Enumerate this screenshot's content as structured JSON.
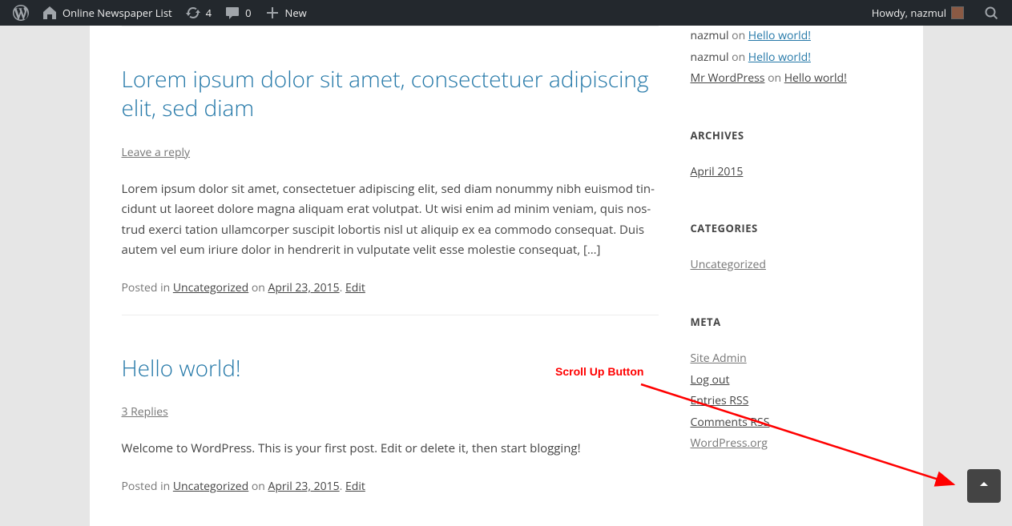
{
  "adminbar": {
    "site_title": "Online Newspaper List",
    "updates_count": "4",
    "comments_count": "0",
    "new_label": "New",
    "howdy": "Howdy, nazmul"
  },
  "posts": [
    {
      "title": "Lorem ipsum dolor sit amet, consectetuer adipiscing elit, sed diam",
      "reply": "Leave a reply",
      "body": "Lorem ipsum dolor sit amet, consectetuer adipiscing elit, sed diam nonummy nibh euismod tin-cidunt ut laoreet dolore magna aliquam erat volutpat. Ut wisi enim ad minim veniam, quis nos-trud exerci tation ullamcorper suscipit lobortis nisl ut aliquip ex ea commodo consequat. Duis autem vel eum iriure dolor in hendrerit in vulputate velit esse molestie consequat, […]",
      "posted_in_label": "Posted in ",
      "category": "Uncategorized",
      "on_label": " on ",
      "date": "April 23, 2015",
      "separator": ". ",
      "edit": "Edit"
    },
    {
      "title": "Hello world!",
      "reply": "3 Replies",
      "body": "Welcome to WordPress. This is your first post. Edit or delete it, then start blogging!",
      "posted_in_label": "Posted in ",
      "category": "Uncategorized",
      "on_label": " on ",
      "date": "April 23, 2015",
      "separator": ". ",
      "edit": "Edit"
    }
  ],
  "sidebar": {
    "recent_comments": [
      {
        "author": "nazmul",
        "on": " on ",
        "post": "Hello world!",
        "author_linked": false
      },
      {
        "author": "nazmul",
        "on": " on ",
        "post": "Hello world!",
        "author_linked": false
      },
      {
        "author": "Mr WordPress",
        "on": " on ",
        "post": "Hello world!",
        "author_linked": true
      }
    ],
    "archives_title": "ARCHIVES",
    "archives": [
      "April 2015"
    ],
    "categories_title": "CATEGORIES",
    "categories": [
      "Uncategorized"
    ],
    "meta_title": "META",
    "meta": [
      "Site Admin",
      "Log out",
      "Entries RSS",
      "Comments RSS",
      "WordPress.org"
    ]
  },
  "annotation": {
    "label": "Scroll Up Button"
  }
}
